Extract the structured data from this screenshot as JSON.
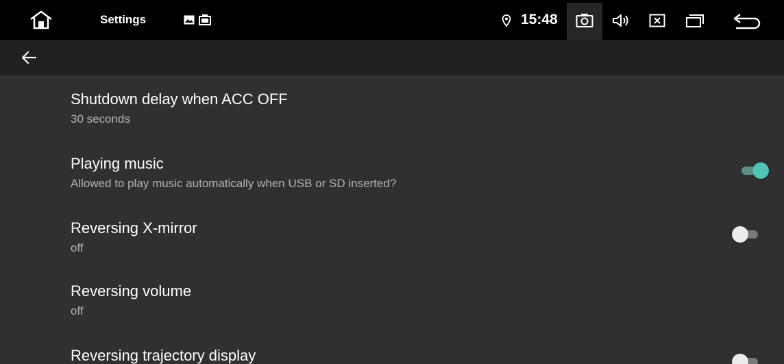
{
  "statusbar": {
    "home_icon": "home-icon",
    "title": "Settings",
    "notification_icons": [
      "image-icon",
      "gallery-icon"
    ],
    "location_icon": "location-pin-icon",
    "time": "15:48",
    "right_icons": [
      "camera-icon",
      "volume-icon",
      "close-box-icon",
      "recent-apps-icon",
      "back-return-icon"
    ]
  },
  "appbar": {
    "back_icon": "arrow-left-icon"
  },
  "preferences": [
    {
      "title": "Shutdown delay when ACC OFF",
      "summary": "30 seconds",
      "has_switch": false
    },
    {
      "title": "Playing music",
      "summary": "Allowed to play music automatically when USB or SD inserted?",
      "has_switch": true,
      "switch_on": true
    },
    {
      "title": "Reversing X-mirror",
      "summary": "off",
      "has_switch": true,
      "switch_on": false
    },
    {
      "title": "Reversing volume",
      "summary": "off",
      "has_switch": false
    },
    {
      "title": "Reversing trajectory display",
      "summary": "",
      "has_switch": true,
      "switch_on": false
    }
  ],
  "colors": {
    "statusbar_bg": "#000000",
    "appbar_bg": "#212121",
    "content_bg": "#303030",
    "title_text": "#ffffff",
    "summary_text": "#b4b4b4",
    "switch_on_thumb": "#4fc4b2",
    "switch_on_track": "#5e8f86",
    "switch_off_thumb": "#ececec",
    "switch_off_track": "#7a7a7a"
  }
}
